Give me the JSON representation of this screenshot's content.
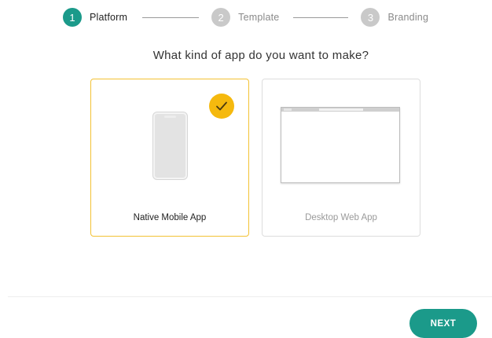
{
  "stepper": {
    "steps": [
      {
        "number": "1",
        "label": "Platform",
        "state": "active"
      },
      {
        "number": "2",
        "label": "Template",
        "state": "inactive"
      },
      {
        "number": "3",
        "label": "Branding",
        "state": "inactive"
      }
    ]
  },
  "question": "What kind of app do you want to make?",
  "options": [
    {
      "label": "Native Mobile App",
      "selected": true,
      "icon": "mobile-phone-icon"
    },
    {
      "label": "Desktop Web App",
      "selected": false,
      "icon": "browser-window-icon"
    }
  ],
  "footer": {
    "next_label": "NEXT"
  },
  "colors": {
    "accent": "#1b9a8a",
    "selected_border": "#f3c234",
    "check_badge": "#f5b90e",
    "inactive_step": "#c9c9c9"
  }
}
